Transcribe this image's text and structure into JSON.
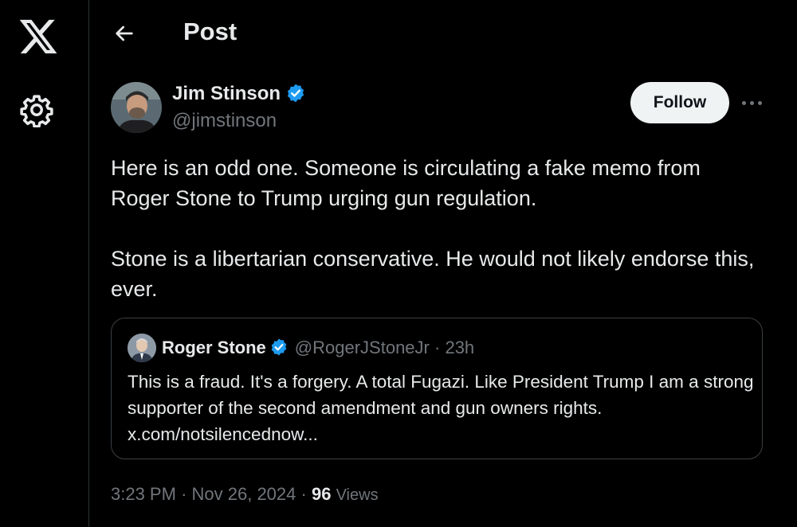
{
  "nav": {
    "logo_icon": "x-logo-icon",
    "settings_icon": "gear-icon"
  },
  "header": {
    "title": "Post",
    "back_icon": "back-arrow-icon"
  },
  "post": {
    "author_name": "Jim Stinson",
    "author_handle": "@jimstinson",
    "follow_label": "Follow",
    "more_icon": "more-icon",
    "paragraphs": [
      "Here is an odd one. Someone is circulating a fake memo from Roger Stone to Trump urging gun regulation.",
      "Stone is a libertarian conservative. He would not likely endorse this, ever."
    ],
    "time": "3:23 PM",
    "separator": "·",
    "date": "Nov 26, 2024",
    "views_count": "96",
    "views_label": "Views"
  },
  "quote": {
    "author_name": "Roger Stone",
    "handle": "@RogerJStoneJr",
    "separator": "·",
    "age": "23h",
    "text": "This is a fraud. It's a forgery. A total Fugazi. Like President Trump I am a strong supporter of the second amendment and gun owners rights. x.com/notsilencednow..."
  },
  "colors": {
    "background": "#000000",
    "text": "#e7e9ea",
    "muted": "#71767b",
    "verified": "#1d9bf0",
    "border": "#2f3336"
  }
}
